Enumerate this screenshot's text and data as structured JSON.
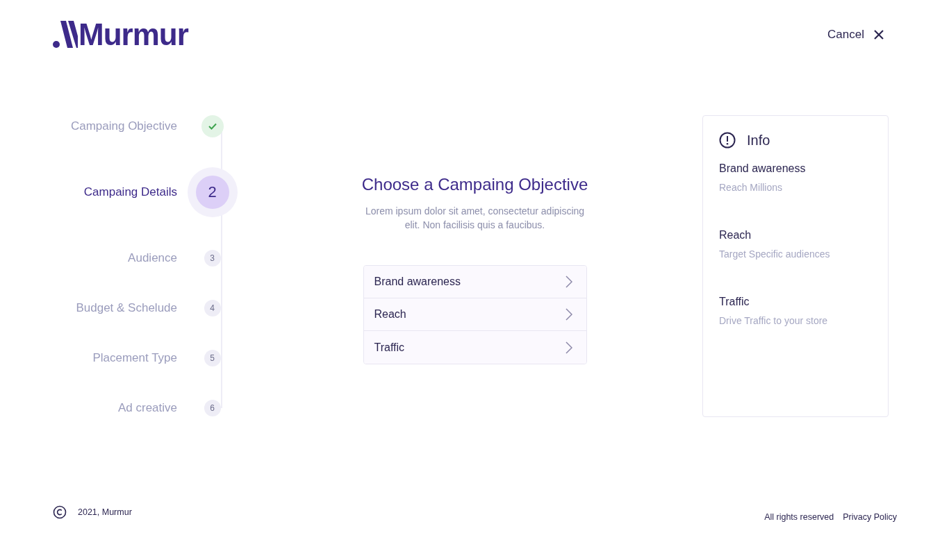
{
  "logo": "Murmur",
  "cancel": "Cancel",
  "steps": [
    {
      "label": "Campaing Objective",
      "kind": "completed"
    },
    {
      "label": "Campaing Details",
      "number": "2",
      "kind": "current"
    },
    {
      "label": "Audience",
      "number": "3",
      "kind": "pending"
    },
    {
      "label": "Budget & Schelude",
      "number": "4",
      "kind": "pending"
    },
    {
      "label": "Placement Type",
      "number": "5",
      "kind": "pending"
    },
    {
      "label": "Ad creative",
      "number": "6",
      "kind": "pending"
    }
  ],
  "heading": "Choose a Campaing Objective",
  "description": "Lorem ipsum dolor sit amet, consectetur adipiscing elit. Non facilisis quis a faucibus.",
  "objectives": [
    "Brand awareness",
    "Reach",
    "Traffic"
  ],
  "info": {
    "title": "Info",
    "items": [
      {
        "title": "Brand awareness",
        "text": "Reach Millions"
      },
      {
        "title": "Reach",
        "text": "Target Specific audiences"
      },
      {
        "title": "Traffic",
        "text": "Drive Traffic to your store"
      }
    ]
  },
  "footer": {
    "copyright": "2021, Murmur",
    "rights": "All rights reserved",
    "privacy": "Privacy Policy"
  }
}
